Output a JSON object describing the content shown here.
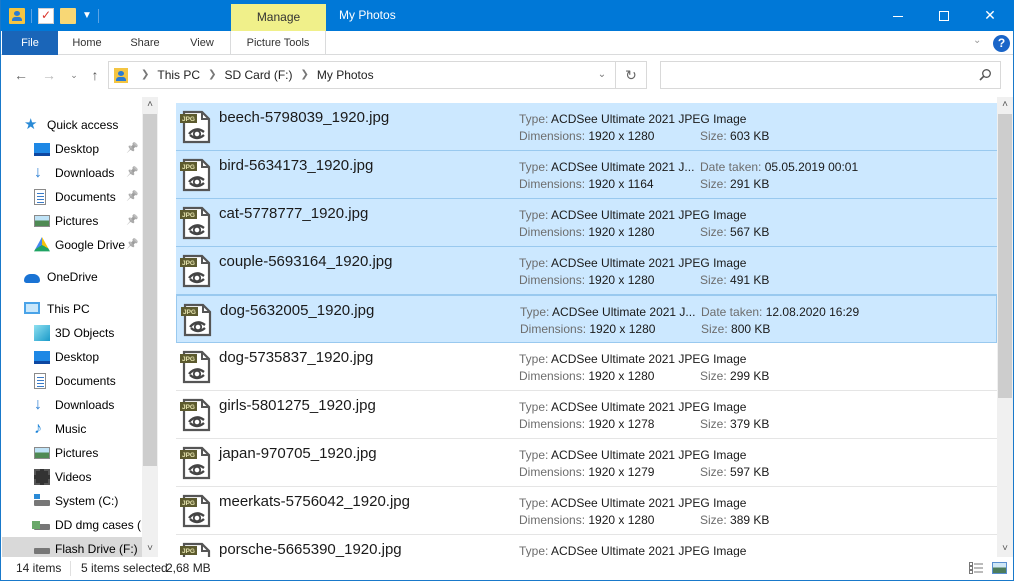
{
  "window": {
    "title": "My Photos",
    "context_tab": "Manage",
    "controls": {
      "minimize": "minimize",
      "maximize": "maximize",
      "close": "✕"
    }
  },
  "ribbon": {
    "tabs": [
      {
        "label": "File"
      },
      {
        "label": "Home"
      },
      {
        "label": "Share"
      },
      {
        "label": "View"
      },
      {
        "label": "Picture Tools"
      }
    ],
    "help": "?"
  },
  "nav": {
    "breadcrumb": [
      "This PC",
      "SD Card (F:)",
      "My Photos"
    ],
    "search_placeholder": ""
  },
  "sidebar": {
    "items": [
      {
        "label": "Quick access",
        "icon": "star-icon",
        "level": 0,
        "pinned": false
      },
      {
        "label": "Desktop",
        "icon": "desktop-icon",
        "level": 1,
        "pinned": true
      },
      {
        "label": "Downloads",
        "icon": "download-icon",
        "level": 1,
        "pinned": true
      },
      {
        "label": "Documents",
        "icon": "documents-icon",
        "level": 1,
        "pinned": true
      },
      {
        "label": "Pictures",
        "icon": "pictures-icon",
        "level": 1,
        "pinned": true
      },
      {
        "label": "Google Drive",
        "icon": "google-drive-icon",
        "level": 1,
        "pinned": true
      },
      {
        "label": "OneDrive",
        "icon": "onedrive-icon",
        "level": 0,
        "pinned": false
      },
      {
        "label": "This PC",
        "icon": "this-pc-icon",
        "level": 0,
        "pinned": false
      },
      {
        "label": "3D Objects",
        "icon": "3d-objects-icon",
        "level": 1,
        "pinned": false
      },
      {
        "label": "Desktop",
        "icon": "desktop-icon",
        "level": 1,
        "pinned": false
      },
      {
        "label": "Documents",
        "icon": "documents-icon",
        "level": 1,
        "pinned": false
      },
      {
        "label": "Downloads",
        "icon": "download-icon",
        "level": 1,
        "pinned": false
      },
      {
        "label": "Music",
        "icon": "music-icon",
        "level": 1,
        "pinned": false
      },
      {
        "label": "Pictures",
        "icon": "pictures-icon",
        "level": 1,
        "pinned": false
      },
      {
        "label": "Videos",
        "icon": "videos-icon",
        "level": 1,
        "pinned": false
      },
      {
        "label": "System (C:)",
        "icon": "system-drive-icon",
        "level": 1,
        "pinned": false
      },
      {
        "label": "DD dmg cases (D",
        "icon": "network-drive-icon",
        "level": 1,
        "pinned": false
      },
      {
        "label": "Flash Drive (F:)",
        "icon": "flash-drive-icon",
        "level": 1,
        "pinned": false,
        "selected": true
      }
    ]
  },
  "labels": {
    "type": "Type:",
    "dimensions": "Dimensions:",
    "size": "Size:",
    "date_taken": "Date taken:"
  },
  "files": [
    {
      "name": "beech-5798039_1920.jpg",
      "type": "ACDSee Ultimate 2021 JPEG Image",
      "dimensions": "1920 x 1280",
      "size": "603 KB",
      "date_taken": null,
      "selected": true
    },
    {
      "name": "bird-5634173_1920.jpg",
      "type": "ACDSee Ultimate 2021 J...",
      "dimensions": "1920 x 1164",
      "size": "291 KB",
      "date_taken": "05.05.2019 00:01",
      "selected": true
    },
    {
      "name": "cat-5778777_1920.jpg",
      "type": "ACDSee Ultimate 2021 JPEG Image",
      "dimensions": "1920 x 1280",
      "size": "567 KB",
      "date_taken": null,
      "selected": true
    },
    {
      "name": "couple-5693164_1920.jpg",
      "type": "ACDSee Ultimate 2021 JPEG Image",
      "dimensions": "1920 x 1280",
      "size": "491 KB",
      "date_taken": null,
      "selected": true
    },
    {
      "name": "dog-5632005_1920.jpg",
      "type": "ACDSee Ultimate 2021 J...",
      "dimensions": "1920 x 1280",
      "size": "800 KB",
      "date_taken": "12.08.2020 16:29",
      "selected": true,
      "focused": true
    },
    {
      "name": "dog-5735837_1920.jpg",
      "type": "ACDSee Ultimate 2021 JPEG Image",
      "dimensions": "1920 x 1280",
      "size": "299 KB",
      "date_taken": null,
      "selected": false
    },
    {
      "name": "girls-5801275_1920.jpg",
      "type": "ACDSee Ultimate 2021 JPEG Image",
      "dimensions": "1920 x 1278",
      "size": "379 KB",
      "date_taken": null,
      "selected": false
    },
    {
      "name": "japan-970705_1920.jpg",
      "type": "ACDSee Ultimate 2021 JPEG Image",
      "dimensions": "1920 x 1279",
      "size": "597 KB",
      "date_taken": null,
      "selected": false
    },
    {
      "name": "meerkats-5756042_1920.jpg",
      "type": "ACDSee Ultimate 2021 JPEG Image",
      "dimensions": "1920 x 1280",
      "size": "389 KB",
      "date_taken": null,
      "selected": false
    },
    {
      "name": "porsche-5665390_1920.jpg",
      "type": "ACDSee Ultimate 2021 JPEG Image",
      "dimensions": "",
      "size": "",
      "date_taken": null,
      "selected": false
    }
  ],
  "status": {
    "item_count": "14 items",
    "selected": "5 items selected",
    "selected_size": "2,68 MB"
  },
  "colors": {
    "titlebar": "#0078d7",
    "file_tab": "#1a65b8",
    "context_tab": "#f0f08a",
    "selection": "#cce8ff",
    "selection_border": "#99c9ef"
  }
}
